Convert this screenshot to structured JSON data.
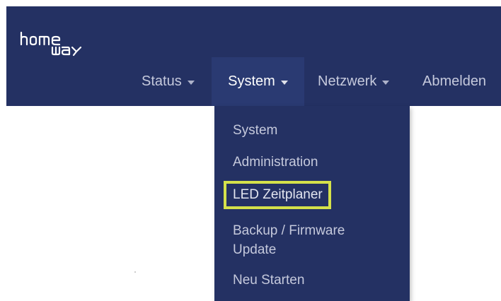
{
  "brand": {
    "logo_line1": "home",
    "logo_line2": "way",
    "bg_color": "#243163",
    "highlight_color": "#d5e14a"
  },
  "nav": {
    "items": [
      {
        "label": "Status",
        "has_caret": true
      },
      {
        "label": "System",
        "has_caret": true,
        "active": true
      },
      {
        "label": "Netzwerk",
        "has_caret": true
      },
      {
        "label": "Abmelden",
        "has_caret": false
      }
    ]
  },
  "dropdown": {
    "items": [
      {
        "label": "System"
      },
      {
        "label": "Administration"
      },
      {
        "label": "LED Zeitplaner",
        "highlighted": true
      },
      {
        "label": "Backup / Firmware",
        "label2": "Update"
      },
      {
        "label": "Neu Starten"
      }
    ]
  }
}
